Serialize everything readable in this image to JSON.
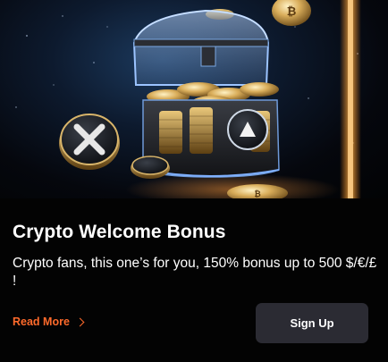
{
  "hero": {
    "image_alt": "Treasure chest filled with crypto coins",
    "accent_color": "#ff6a2b",
    "glow_color": "#ff8a1e"
  },
  "promo": {
    "title": "Crypto Welcome Bonus",
    "description": "Crypto fans, this one’s for you, 150% bonus up to 500 $/€/£ !"
  },
  "actions": {
    "read_more_label": "Read More",
    "read_more_icon": "chevron-right-icon",
    "signup_label": "Sign Up"
  }
}
